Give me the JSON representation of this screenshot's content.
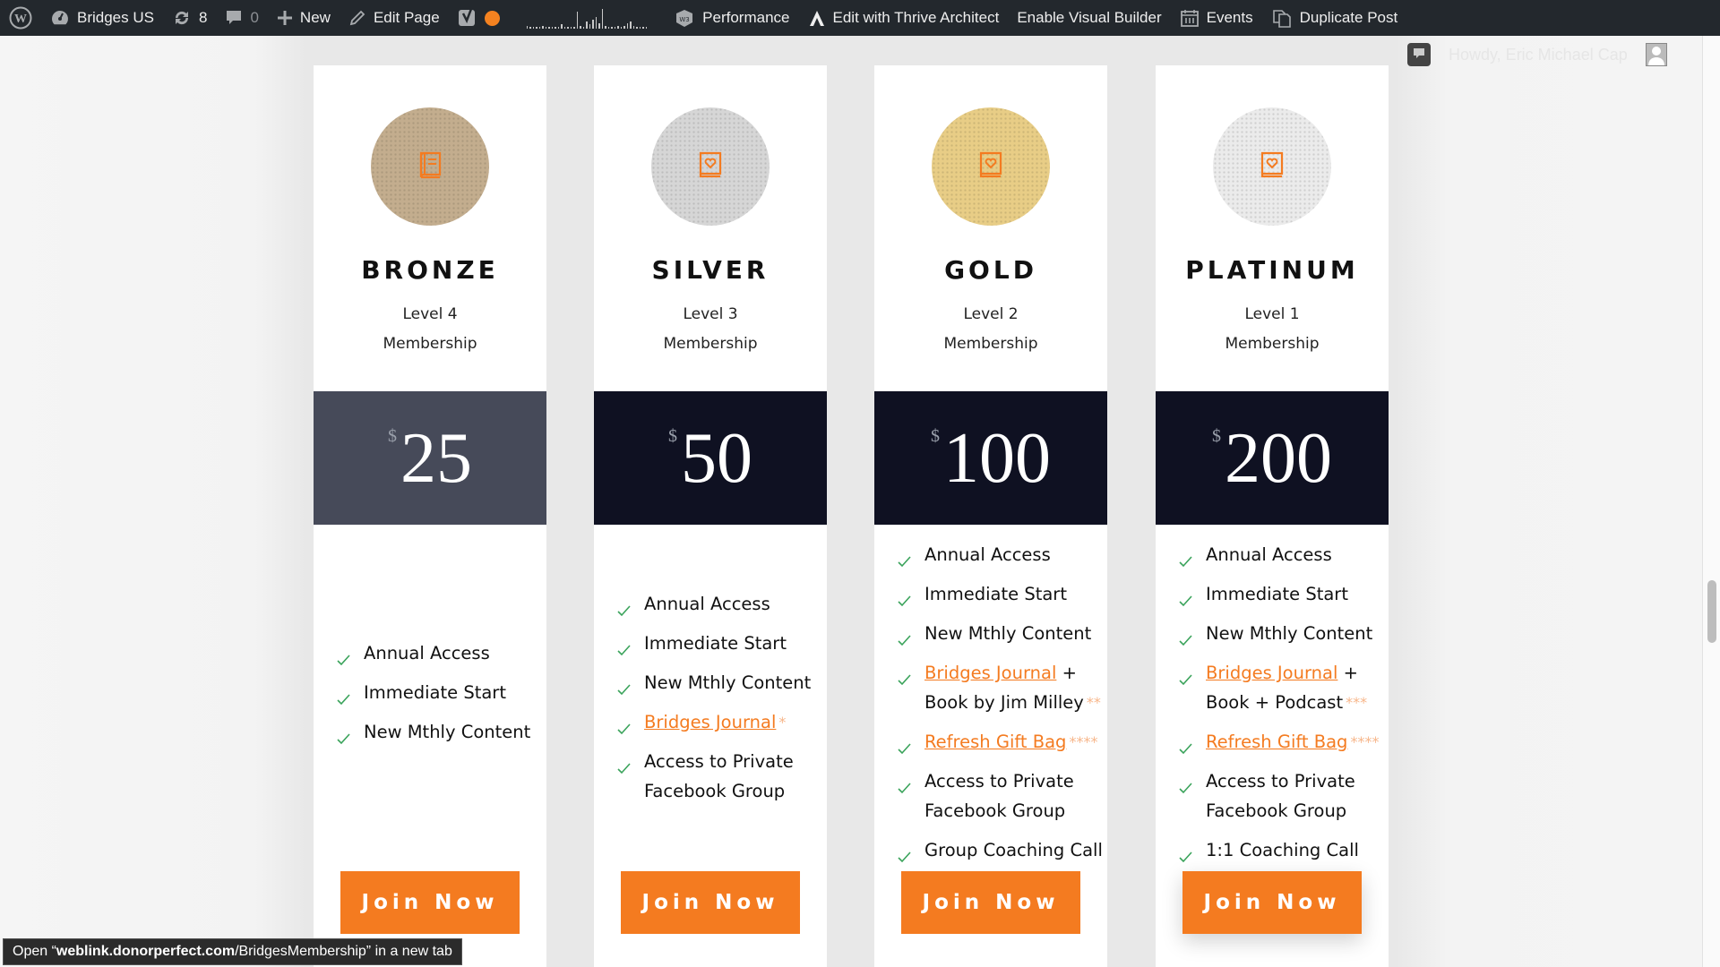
{
  "adminbar": {
    "site_name": "Bridges US",
    "updates_count": "8",
    "comments_count": "0",
    "new_label": "New",
    "edit_label": "Edit Page",
    "performance_label": "Performance",
    "thrive_label": "Edit with Thrive Architect",
    "visual_builder_label": "Enable Visual Builder",
    "events_label": "Events",
    "duplicate_label": "Duplicate Post",
    "seo_status_color": "#f48220",
    "howdy": "Howdy, Eric Michael Cap"
  },
  "tiers": [
    {
      "name": "BRONZE",
      "level": "Level 4",
      "subtitle": "Membership",
      "circle_color": "#c3ad8e",
      "icon": "book-icon",
      "band_color": "#464a59",
      "currency": "$",
      "price": "25",
      "features": [
        {
          "text": "Annual Access"
        },
        {
          "text": "Immediate Start"
        },
        {
          "text": "New Mthly Content"
        }
      ],
      "button": "Join Now"
    },
    {
      "name": "SILVER",
      "level": "Level 3",
      "subtitle": "Membership",
      "circle_color": "#d6d6d6",
      "icon": "book-heart-icon",
      "band_color": "#0f1122",
      "currency": "$",
      "price": "50",
      "features": [
        {
          "text": "Annual Access"
        },
        {
          "text": "Immediate Start"
        },
        {
          "text": "New Mthly Content"
        },
        {
          "link": "Bridges Journal",
          "mark": "*"
        },
        {
          "text": "Access to Private Facebook Group"
        }
      ],
      "button": "Join Now"
    },
    {
      "name": "GOLD",
      "level": "Level 2",
      "subtitle": "Membership",
      "circle_color": "#e8cd86",
      "icon": "book-heart-icon",
      "band_color": "#0f1122",
      "currency": "$",
      "price": "100",
      "features": [
        {
          "text": "Annual Access"
        },
        {
          "text": "Immediate Start"
        },
        {
          "text": "New Mthly Content"
        },
        {
          "link": "Bridges Journal",
          "text_after": " + Book by Jim Milley",
          "mark": "**"
        },
        {
          "link": "Refresh Gift Bag",
          "mark": "****"
        },
        {
          "text": "Access to Private Facebook Group"
        },
        {
          "text": "Group Coaching Call"
        }
      ],
      "button": "Join Now"
    },
    {
      "name": "PLATINUM",
      "level": "Level 1",
      "subtitle": "Membership",
      "circle_color": "#ebebeb",
      "icon": "book-heart-icon",
      "band_color": "#0f1122",
      "currency": "$",
      "price": "200",
      "features": [
        {
          "text": "Annual Access"
        },
        {
          "text": "Immediate Start"
        },
        {
          "text": "New Mthly Content"
        },
        {
          "link": "Bridges Journal",
          "text_after": " + Book + Podcast",
          "mark": "***"
        },
        {
          "link": "Refresh Gift Bag",
          "mark": "****"
        },
        {
          "text": "Access to Private Facebook Group"
        },
        {
          "text": "1:1 Coaching Call"
        }
      ],
      "button": "Join Now"
    }
  ],
  "status_bar": {
    "prefix": "Open “",
    "domain": "weblink.donorperfect.com",
    "path": "/BridgesMembership” in a new tab"
  },
  "colors": {
    "accent": "#f47b20",
    "check": "#3aa35b",
    "adminbar": "#23282d"
  }
}
